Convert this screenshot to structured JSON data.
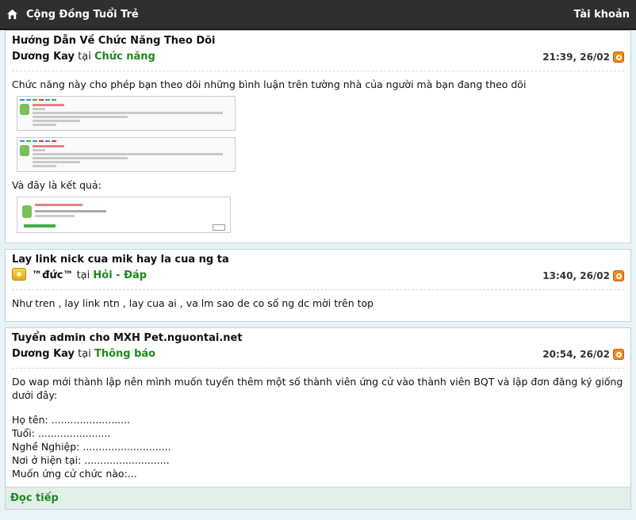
{
  "header": {
    "title": "Cộng Đồng Tuổi Trẻ",
    "account_label": "Tài khoản"
  },
  "posts": [
    {
      "title": "Hướng Dẫn Về Chức Năng Theo Dõi",
      "author": "Dương Kay",
      "at": "tại",
      "category": "Chức năng",
      "time": "21:39, 26/02",
      "paragraph1": "Chức năng này cho phép bạn theo dõi những bình luận trên tường nhà của người mà bạn đang theo dõi",
      "paragraph2": "Và đây là kết quả:"
    },
    {
      "title": "Lay link nick cua mik hay la cua ng ta",
      "author": "™đức™",
      "at": "tại",
      "category": "Hỏi - Đáp",
      "time": "13:40, 26/02",
      "paragraph1": "Như tren , lay link ntn , lay cua ai , va lm sao de co số ng dc mời trên top"
    },
    {
      "title": "Tuyển admin cho MXH Pet.nguontai.net",
      "author": "Dương Kay",
      "at": "tại",
      "category": "Thông báo",
      "time": "20:54, 26/02",
      "paragraph1": "Do wap mới thành lập nên mình muốn tuyển thêm một số thành viên ứng cử vào thành viên BQT và lập đơn đăng ký giống dưới đây:",
      "form": [
        "Họ tên: .........................",
        "Tuổi: .......................",
        "Nghề Nghiệp: ............................",
        "Nơi ở hiện tại: ...........................",
        "Muốn ứng cử chức nào:..."
      ],
      "readmore": "Đọc tiếp"
    }
  ],
  "colors": {
    "topbar": "#2f2f2f",
    "category": "#1c8a1c",
    "rss": "#f28a1e"
  },
  "icons": [
    "home-icon",
    "rss-icon",
    "user-icon"
  ]
}
